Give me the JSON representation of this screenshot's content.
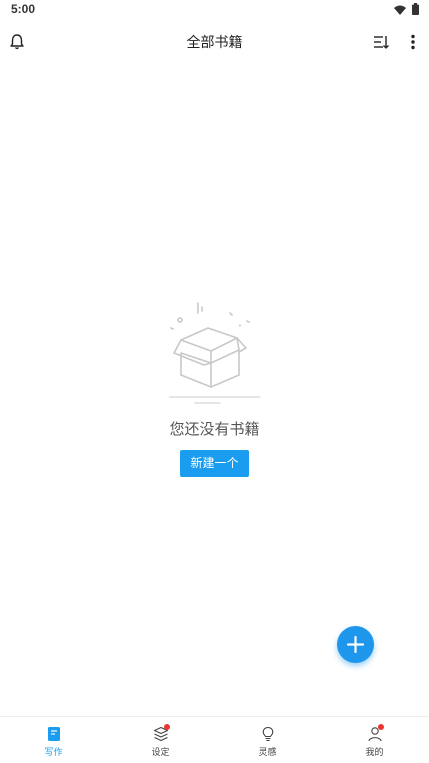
{
  "status_bar": {
    "time": "5:00",
    "icons": [
      "wifi-icon",
      "battery-icon"
    ]
  },
  "app_bar": {
    "title": "全部书籍",
    "left_icon": "bell-icon",
    "right_icons": [
      "sort-icon",
      "more-vertical-icon"
    ]
  },
  "empty_state": {
    "illustration": "empty-box-icon",
    "message": "您还没有书籍",
    "button_label": "新建一个"
  },
  "fab": {
    "icon": "plus-icon"
  },
  "bottom_nav": {
    "items": [
      {
        "label": "写作",
        "icon": "book-icon",
        "active": true,
        "badge": false
      },
      {
        "label": "设定",
        "icon": "layers-icon",
        "active": false,
        "badge": true
      },
      {
        "label": "灵感",
        "icon": "lightbulb-icon",
        "active": false,
        "badge": false
      },
      {
        "label": "我的",
        "icon": "user-icon",
        "active": false,
        "badge": true
      }
    ]
  },
  "colors": {
    "accent": "#1a9cf0",
    "badge": "#ee3333",
    "background": "#ffffff",
    "text": "#222222"
  }
}
